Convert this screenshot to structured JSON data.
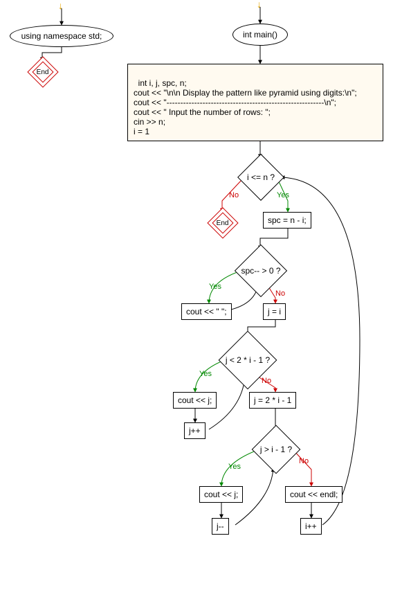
{
  "nodes": {
    "using_ns": "using namespace std;",
    "end1": "End",
    "int_main": "int main()",
    "codebox": "int i, j, spc, n;\ncout << \"\\n\\n Display the pattern like pyramid using digits:\\n\";\ncout << \"---------------------------------------------------------\\n\";\ncout << \" Input the number of rows: \";\ncin >> n;\ni = 1",
    "cond_i": "i <= n ?",
    "end2": "End",
    "spc_assign": "spc = n - i;",
    "cond_spc": "spc-- > 0 ?",
    "cout_space": "cout << \" \";",
    "j_eq_i": "j = i",
    "cond_j_lt": "j < 2 * i - 1 ?",
    "cout_j1": "cout << j;",
    "j_assign": "j = 2 * i - 1",
    "jpp": "j++",
    "cond_j_gt": "j > i - 1 ?",
    "cout_j2": "cout << j;",
    "cout_endl": "cout << endl;",
    "jmm": "j--",
    "ipp": "i++"
  },
  "labels": {
    "yes": "Yes",
    "no": "No"
  }
}
